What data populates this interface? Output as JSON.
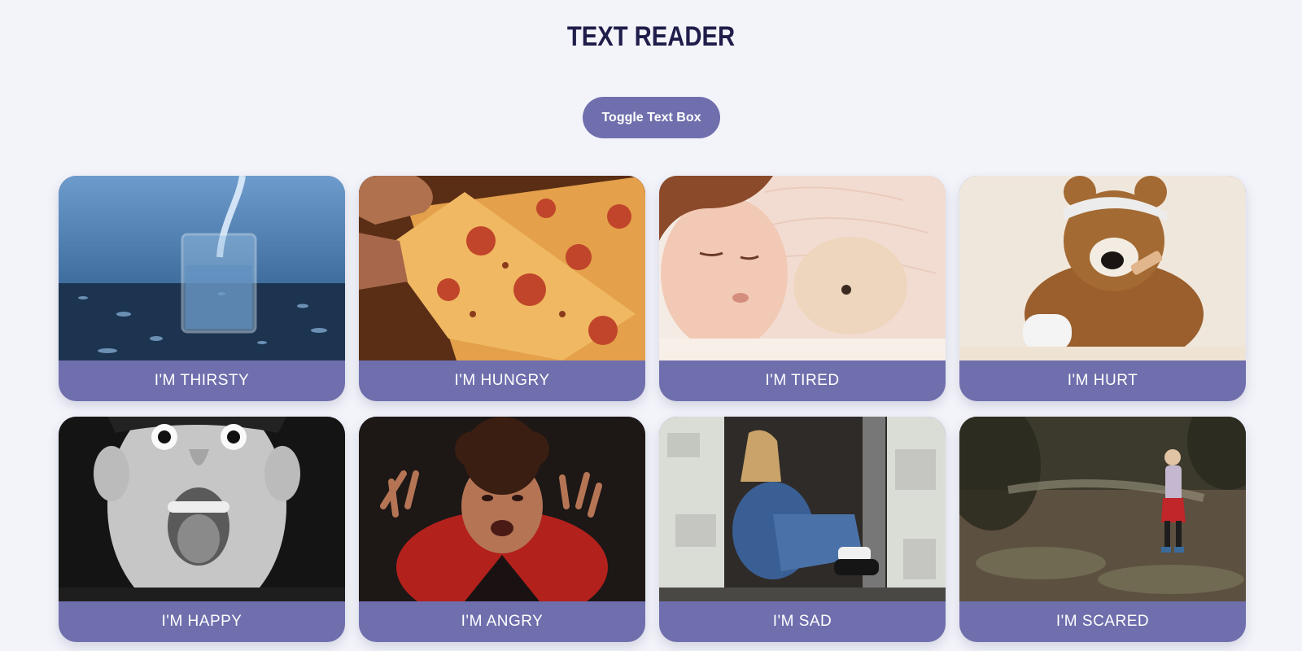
{
  "header": {
    "title": "TEXT READER"
  },
  "toolbar": {
    "toggle_label": "Toggle Text Box"
  },
  "cards": [
    {
      "label": "I'M THIRSTY",
      "image": "glass-of-water"
    },
    {
      "label": "I'M HUNGRY",
      "image": "pizza-slice"
    },
    {
      "label": "I'M TIRED",
      "image": "sleeping-child-with-teddy"
    },
    {
      "label": "I'M HURT",
      "image": "bandaged-teddy-bear"
    },
    {
      "label": "I'M HAPPY",
      "image": "excited-boy"
    },
    {
      "label": "I'M ANGRY",
      "image": "angry-boy"
    },
    {
      "label": "I'M SAD",
      "image": "sad-child-in-doorway"
    },
    {
      "label": "I'M SCARED",
      "image": "scared-child-in-woods"
    }
  ],
  "colors": {
    "accent": "#6f6fae",
    "title": "#1f1d4a",
    "background": "#f3f4fa"
  }
}
